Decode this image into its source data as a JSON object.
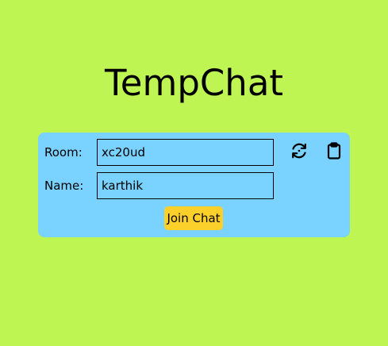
{
  "app": {
    "title": "TempChat"
  },
  "form": {
    "room_label": "Room:",
    "room_value": "xc20ud",
    "name_label": "Name:",
    "name_value": "karthik",
    "join_label": "Join Chat"
  },
  "icons": {
    "refresh": "refresh-icon",
    "clipboard": "clipboard-icon"
  },
  "colors": {
    "background": "#bef552",
    "card": "#79d2ff",
    "join_button": "#fcd02a"
  }
}
